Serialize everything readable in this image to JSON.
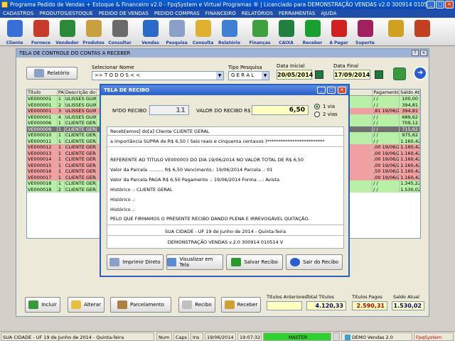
{
  "window": {
    "title": "Programa Pedido de Vendas + Estoque & Financeiro v2.0 - FpqSystem e Virtual Programas ® | Licenciado para  DEMONSTRAÇÃO VENDAS v2.0 300914 010514 V"
  },
  "menu": [
    "CADASTROS",
    "PRODUTOS/ESTOQUE",
    "PEDIDO DE VENDAS",
    "PEDIDO COMPRAS",
    "FINANCEIRO",
    "RELATÓRIOS",
    "FERRAMENTAS",
    "AJUDA"
  ],
  "toolbar": [
    {
      "label": "Cliente",
      "icon": "client-icon",
      "color": "#3b6fd8"
    },
    {
      "label": "Fornece",
      "icon": "supplier-icon",
      "color": "#c83b2a"
    },
    {
      "label": "Vendedor",
      "icon": "seller-icon",
      "color": "#2a8a3a"
    },
    {
      "label": "Produtos",
      "icon": "boxes-icon",
      "color": "#c8a040"
    },
    {
      "label": "Consultar",
      "icon": "magnifier-icon",
      "color": "#6a6a6a"
    },
    {
      "label": "Vendas",
      "icon": "monitor-icon",
      "color": "#2a6ac8"
    },
    {
      "label": "Pesquisa",
      "icon": "search-doc-icon",
      "color": "#8aa0c8"
    },
    {
      "label": "Consulta",
      "icon": "folder-icon",
      "color": "#e0b030"
    },
    {
      "label": "Relatório",
      "icon": "report-icon",
      "color": "#4080d0"
    },
    {
      "label": "Finanças",
      "icon": "finance-icon",
      "color": "#40a040"
    },
    {
      "label": "CAIXA",
      "icon": "cash-icon",
      "color": "#208040"
    },
    {
      "label": "Receber",
      "icon": "dollar-green-icon",
      "color": "#18a030"
    },
    {
      "label": "A Pagar",
      "icon": "dollar-red-icon",
      "color": "#d02020"
    },
    {
      "label": "Suporte",
      "icon": "support-icon",
      "color": "#a02060"
    },
    {
      "label": "",
      "icon": "coins-icon",
      "color": "#d0a020"
    },
    {
      "label": "",
      "icon": "exit-icon",
      "color": "#c04020"
    }
  ],
  "main": {
    "title": "TELA DE CONTROLE DO CONTAS A RECEBER",
    "relatorio_label": "Relatório",
    "selecionar_label": "Selecionar Nome",
    "selecionar_value": ">> T O D O S < <",
    "tipo_label": "Tipo  Pesquisa",
    "tipo_value": "G E R A L",
    "data_inicial_label": "Data Inicial",
    "data_inicial": "20/05/2014",
    "data_final_label": "Data Final",
    "data_final": "17/09/2014",
    "columns": [
      "Título",
      "PA",
      "Descrição do C",
      "",
      "Pagamento",
      "Saldo Atual"
    ],
    "rows": [
      {
        "t": "VE000001",
        "pa": "1",
        "d": "ULISSES GUIM",
        "pg": "/ /",
        "s": "100,00",
        "c": "green"
      },
      {
        "t": "VE000001",
        "pa": "2",
        "d": "ULISSES GUIM",
        "pg": "/ /",
        "s": "394,81",
        "c": "green"
      },
      {
        "t": "VE000001",
        "pa": "3",
        "d": "ULISSES GUIM",
        "pg": ",81  19/06/2014",
        "s": "394,81",
        "c": "red"
      },
      {
        "t": "VE000001",
        "pa": "4",
        "d": "ULISSES GUIM",
        "pg": "/ /",
        "s": "689,62",
        "c": "green"
      },
      {
        "t": "VE000006",
        "pa": "1",
        "d": "CLIENTE GERA",
        "pg": "/ /",
        "s": "709,12",
        "c": "green"
      },
      {
        "t": "VE000009",
        "pa": "1",
        "d": "CLIENTE GERA",
        "pg": "/ /",
        "s": "715,62",
        "c": "sel-row"
      },
      {
        "t": "VE000010",
        "pa": "1",
        "d": "CLIENTE GERA",
        "pg": "/ /",
        "s": "975,62",
        "c": "green"
      },
      {
        "t": "VE000011",
        "pa": "1",
        "d": "CLIENTE GERA",
        "pg": "/ /",
        "s": "1.160,42",
        "c": "green"
      },
      {
        "t": "VE000012",
        "pa": "1",
        "d": "CLIENTE GERA",
        "pg": ",00  19/06/2014",
        "s": "1.160,42",
        "c": "red"
      },
      {
        "t": "VE000013",
        "pa": "1",
        "d": "CLIENTE GERA",
        "pg": ",00  19/06/2014",
        "s": "1.160,42",
        "c": "red"
      },
      {
        "t": "VE000014",
        "pa": "1",
        "d": "CLIENTE GERA",
        "pg": ",00  19/06/2014",
        "s": "1.160,42",
        "c": "red"
      },
      {
        "t": "VE000015",
        "pa": "1",
        "d": "CLIENTE GERA",
        "pg": ",00  19/06/2014",
        "s": "1.160,42",
        "c": "red"
      },
      {
        "t": "VE000016",
        "pa": "1",
        "d": "CLIENTE GERA",
        "pg": ",50  19/06/2014",
        "s": "1.160,42",
        "c": "red"
      },
      {
        "t": "VE000017",
        "pa": "1",
        "d": "CLIENTE GERA",
        "pg": ",00  19/06/2014",
        "s": "1.160,42",
        "c": "red"
      },
      {
        "t": "VE000018",
        "pa": "1",
        "d": "CLIENTE GERA",
        "pg": "/ /",
        "s": "1.345,22",
        "c": "green"
      },
      {
        "t": "VE000018",
        "pa": "2",
        "d": "CLIENTE GERA",
        "pg": "/ /",
        "s": "1.530,02",
        "c": "green"
      }
    ],
    "buttons": {
      "incluir": "Incluir",
      "alterar": "Alterar",
      "parcelamento": "Parcelamento",
      "recibo": "Recibo",
      "receber": "Receber"
    },
    "totals": {
      "titulos_anteriores_label": "Títulos Anteriores",
      "total_titulos_label": "Total Títulos",
      "total_titulos": "4.120,33",
      "titulos_pagos_label": "Títulos Pagos",
      "titulos_pagos": "2.590,31",
      "saldo_atual_label": "Saldo Atual",
      "saldo_atual": "1.530,02"
    }
  },
  "dialog": {
    "title": "TELA DE RECIBO",
    "nro_label": "NºDO RECIBO",
    "nro_value": "11",
    "valor_label": "VALOR DO RECIBO R$",
    "valor_value": "6,50",
    "via1": "1 via",
    "via2": "2 vias",
    "lines": {
      "l1": "Receb[emos] do[a] Cliente CLIENTE GERAL",
      "l2": "a importância SUPRA de R$        6,50 ( Seis reais e cinquenta  centavos )*************************",
      "l3": "REFERENTE AO TITULO   VE000003    DO DIA 19/06/2014   NO VALOR TOTAL DE R$          6,50",
      "l4": "Valor da Parcela .......... R$        6,50  Vencimento.:  19/06/2014   Parcela .:  01",
      "l5": "Valor da Parcela PAGA R$        6,50  Pagamento .:  19/06/2014   Forma ...:  Avista",
      "l6": "Histórico .: CLIENTE GERAL",
      "l7": "Histórico .:",
      "l8": "Histórico .:",
      "l9": "PELO QUE FIRMAMOS O PRESENTE RECIBO DANDO PLENA E IRREVOGÁVEL QUITAÇÃO.",
      "l10": "SUA CIDADE - UF 19 de Junho de 2014 - Quinta-feira",
      "l11": "DEMONSTRAÇÃO VENDAS v.2.0 300914 010514 V"
    },
    "buttons": {
      "imprimir": "Imprimir Direto",
      "visualizar": "Visualizar em Tela",
      "salvar": "Salvar Recibo",
      "sair": "Sair do Recibo"
    }
  },
  "status": {
    "cidade": "SUA CIDADE - UF 19 de Junho de 2014 - Quinta-feira",
    "num": "Num",
    "caps": "Caps",
    "ins": "Ins",
    "date": "19/06/2014",
    "time": "19:07:32",
    "master": "MASTER",
    "demo": "DEMO Vendas 2.0",
    "brand": "FpqSystem"
  }
}
